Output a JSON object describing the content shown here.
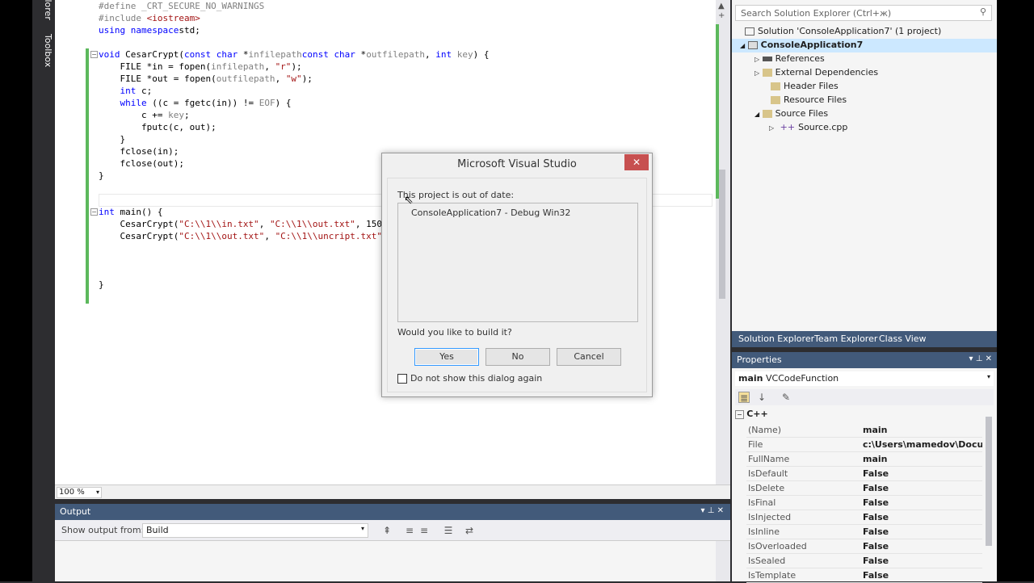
{
  "tool_tabs": [
    "Solution Explorer",
    "Toolbox"
  ],
  "editor": {
    "zoom": "100 %",
    "code_lines": [
      {
        "parts": [
          [
            "pp",
            "#define _CRT_SECURE_NO_WARNINGS"
          ]
        ]
      },
      {
        "parts": [
          [
            "pp",
            "#include "
          ],
          [
            "str",
            "<iostream>"
          ]
        ]
      },
      {
        "parts": [
          [
            "kw",
            "using namespace"
          ],
          [
            "",
            "std;"
          ]
        ]
      },
      {
        "parts": [
          [
            "",
            ""
          ]
        ]
      },
      {
        "parts": [
          [
            "kw",
            "void"
          ],
          [
            "",
            " CesarCrypt("
          ],
          [
            "kw",
            "const char"
          ],
          [
            "",
            " *"
          ],
          [
            "pp",
            "infilepath"
          ],
          [
            ", ",
            ""
          ],
          [
            "kw",
            "const char"
          ],
          [
            "",
            " *"
          ],
          [
            "pp",
            "outfilepath"
          ],
          [
            "",
            ", "
          ],
          [
            "kw",
            "int"
          ],
          [
            "",
            " "
          ],
          [
            "pp",
            "key"
          ],
          [
            "",
            ") {"
          ]
        ]
      },
      {
        "parts": [
          [
            "",
            "    FILE *in = fopen("
          ],
          [
            "pp",
            "infilepath"
          ],
          [
            "",
            ", "
          ],
          [
            "str",
            "\"r\""
          ],
          [
            "",
            ");"
          ]
        ]
      },
      {
        "parts": [
          [
            "",
            "    FILE *out = fopen("
          ],
          [
            "pp",
            "outfilepath"
          ],
          [
            "",
            ", "
          ],
          [
            "str",
            "\"w\""
          ],
          [
            "",
            ");"
          ]
        ]
      },
      {
        "parts": [
          [
            "",
            "    "
          ],
          [
            "kw",
            "int"
          ],
          [
            "",
            " c;"
          ]
        ]
      },
      {
        "parts": [
          [
            "",
            "    "
          ],
          [
            "kw",
            "while"
          ],
          [
            "",
            " ((c = fgetc(in)) != "
          ],
          [
            "pp",
            "EOF"
          ],
          [
            "",
            ") {"
          ]
        ]
      },
      {
        "parts": [
          [
            "",
            "        c += "
          ],
          [
            "pp",
            "key"
          ],
          [
            "",
            ";"
          ]
        ]
      },
      {
        "parts": [
          [
            "",
            "        fputc(c, out);"
          ]
        ]
      },
      {
        "parts": [
          [
            "",
            "    }"
          ]
        ]
      },
      {
        "parts": [
          [
            "",
            "    fclose(in);"
          ]
        ]
      },
      {
        "parts": [
          [
            "",
            "    fclose(out);"
          ]
        ]
      },
      {
        "parts": [
          [
            "",
            "}"
          ]
        ]
      },
      {
        "parts": [
          [
            "",
            ""
          ]
        ]
      },
      {
        "parts": [
          [
            "",
            ""
          ]
        ]
      },
      {
        "parts": [
          [
            "kw",
            "int"
          ],
          [
            "",
            " main() {"
          ]
        ]
      },
      {
        "parts": [
          [
            "",
            "    CesarCrypt("
          ],
          [
            "str",
            "\"C:\\\\1\\\\in.txt\""
          ],
          [
            "",
            ", "
          ],
          [
            "str",
            "\"C:\\\\1\\\\out.txt\""
          ],
          [
            "",
            ", 150"
          ]
        ]
      },
      {
        "parts": [
          [
            "",
            "    CesarCrypt("
          ],
          [
            "str",
            "\"C:\\\\1\\\\out.txt\""
          ],
          [
            "",
            ", "
          ],
          [
            "str",
            "\"C:\\\\1\\\\uncript.txt\""
          ]
        ]
      },
      {
        "parts": [
          [
            "",
            ""
          ]
        ]
      },
      {
        "parts": [
          [
            "",
            ""
          ]
        ]
      },
      {
        "parts": [
          [
            "",
            ""
          ]
        ]
      },
      {
        "parts": [
          [
            "",
            "}"
          ]
        ]
      }
    ]
  },
  "output": {
    "title": "Output",
    "show_from_label": "Show output from:",
    "source": "Build"
  },
  "solution_explorer": {
    "search_placeholder": "Search Solution Explorer (Ctrl+ж)",
    "solution": "Solution 'ConsoleApplication7' (1 project)",
    "project": "ConsoleApplication7",
    "items": [
      "References",
      "External Dependencies",
      "Header Files",
      "Resource Files",
      "Source Files"
    ],
    "source_file": "Source.cpp",
    "tabs": [
      "Solution Explorer",
      "Team Explorer",
      "Class View"
    ]
  },
  "properties": {
    "title": "Properties",
    "object_name": "main",
    "object_type": "VCCodeFunction",
    "category": "C++",
    "rows": [
      {
        "name": "(Name)",
        "value": "main"
      },
      {
        "name": "File",
        "value": "c:\\Users\\mamedov\\Docume"
      },
      {
        "name": "FullName",
        "value": "main"
      },
      {
        "name": "IsDefault",
        "value": "False"
      },
      {
        "name": "IsDelete",
        "value": "False"
      },
      {
        "name": "IsFinal",
        "value": "False"
      },
      {
        "name": "IsInjected",
        "value": "False"
      },
      {
        "name": "IsInline",
        "value": "False"
      },
      {
        "name": "IsOverloaded",
        "value": "False"
      },
      {
        "name": "IsSealed",
        "value": "False"
      },
      {
        "name": "IsTemplate",
        "value": "False"
      }
    ]
  },
  "dialog": {
    "title": "Microsoft Visual Studio",
    "close": "✕",
    "message": "This project is out of date:",
    "project_item": "ConsoleApplication7 - Debug Win32",
    "question": "Would you like to build it?",
    "yes": "Yes",
    "no": "No",
    "cancel": "Cancel",
    "checkbox_label": "Do not show this dialog again"
  }
}
